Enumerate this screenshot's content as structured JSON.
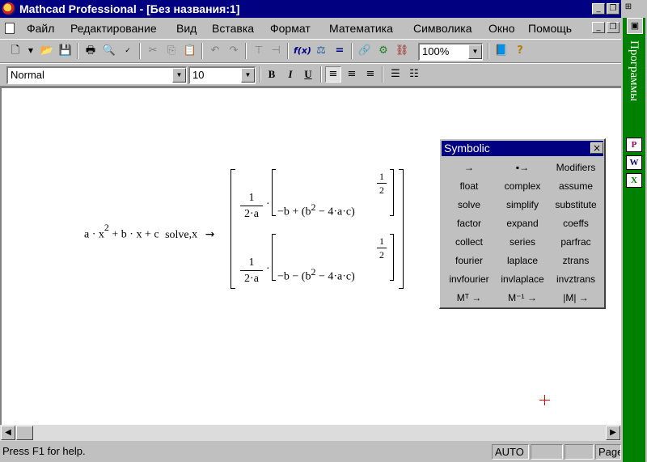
{
  "window": {
    "title": "Mathcad Professional - [Без названия:1]"
  },
  "caption_buttons": {
    "minimize": "_",
    "restore": "❐",
    "close": "×"
  },
  "menu": [
    "Файл",
    "Редактирование",
    "Вид",
    "Вставка",
    "Формат",
    "Математика",
    "Символика",
    "Окно",
    "Помощь"
  ],
  "toolbar": {
    "zoom": "100%"
  },
  "format_bar": {
    "style": "Normal",
    "font_size": "10",
    "bold": "B",
    "italic": "I",
    "underline": "U"
  },
  "worksheet": {
    "expression": {
      "lhs_a": "a",
      "lhs_x": "x",
      "lhs_exp": "2",
      "lhs_b": "b",
      "lhs_x2": "x",
      "lhs_c": "c",
      "keyword": "solve",
      "var": "x",
      "arrow": "→",
      "sol1": {
        "num": "1",
        "den": "2·a",
        "inner": "−b + (b",
        "exp": "2",
        "tail": "− 4·a·c)",
        "pow_num": "1",
        "pow_den": "2"
      },
      "sol2": {
        "num": "1",
        "den": "2·a",
        "inner": "−b − (b",
        "exp": "2",
        "tail": "− 4·a·c)",
        "pow_num": "1",
        "pow_den": "2"
      }
    }
  },
  "symbolic_palette": {
    "title": "Symbolic",
    "buttons": [
      "→",
      "▪→",
      "Modifiers",
      "float",
      "complex",
      "assume",
      "solve",
      "simplify",
      "substitute",
      "factor",
      "expand",
      "coeffs",
      "collect",
      "series",
      "parfrac",
      "fourier",
      "laplace",
      "ztrans",
      "invfourier",
      "invlaplace",
      "invztrans",
      "Mᵀ →",
      "M⁻¹ →",
      "|M| →"
    ]
  },
  "statusbar": {
    "help": "Press F1 for help.",
    "mode": "AUTO",
    "page": "Page"
  },
  "office_bar": {
    "label": "Программы",
    "icons": [
      "P",
      "W",
      "X"
    ]
  }
}
